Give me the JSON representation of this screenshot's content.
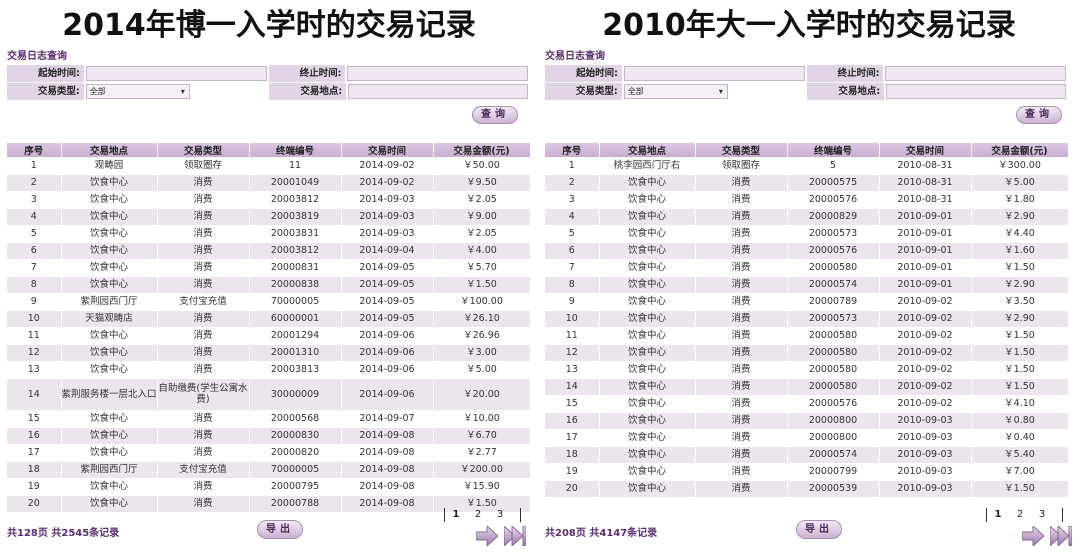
{
  "left": {
    "heading": "2014年博一入学时的交易记录",
    "section_title": "交易日志查询",
    "form": {
      "start_label": "起始时间:",
      "end_label": "终止时间:",
      "type_label": "交易类型:",
      "type_value": "全部",
      "place_label": "交易地点:"
    },
    "query_button": "查询",
    "columns": [
      "序号",
      "交易地点",
      "交易类型",
      "终端编号",
      "交易时间",
      "交易金额(元)"
    ],
    "rows": [
      [
        "1",
        "观畴园",
        "领取圈存",
        "11",
        "2014-09-02",
        "￥50.00"
      ],
      [
        "2",
        "饮食中心",
        "消费",
        "20001049",
        "2014-09-02",
        "￥9.50"
      ],
      [
        "3",
        "饮食中心",
        "消费",
        "20003812",
        "2014-09-03",
        "￥2.05"
      ],
      [
        "4",
        "饮食中心",
        "消费",
        "20003819",
        "2014-09-03",
        "￥9.00"
      ],
      [
        "5",
        "饮食中心",
        "消费",
        "20003831",
        "2014-09-03",
        "￥2.05"
      ],
      [
        "6",
        "饮食中心",
        "消费",
        "20003812",
        "2014-09-04",
        "￥4.00"
      ],
      [
        "7",
        "饮食中心",
        "消费",
        "20000831",
        "2014-09-05",
        "￥5.70"
      ],
      [
        "8",
        "饮食中心",
        "消费",
        "20000838",
        "2014-09-05",
        "￥1.50"
      ],
      [
        "9",
        "紫荆园西门厅",
        "支付宝充值",
        "70000005",
        "2014-09-05",
        "￥100.00"
      ],
      [
        "10",
        "天猫观畴店",
        "消费",
        "60000001",
        "2014-09-05",
        "￥26.10"
      ],
      [
        "11",
        "饮食中心",
        "消费",
        "20001294",
        "2014-09-06",
        "￥26.96"
      ],
      [
        "12",
        "饮食中心",
        "消费",
        "20001310",
        "2014-09-06",
        "￥3.00"
      ],
      [
        "13",
        "饮食中心",
        "消费",
        "20003813",
        "2014-09-06",
        "￥5.00"
      ],
      [
        "14",
        "紫荆服务楼一层北入口",
        "自助缴费(学生公寓水费)",
        "30000009",
        "2014-09-06",
        "￥20.00"
      ],
      [
        "15",
        "饮食中心",
        "消费",
        "20000568",
        "2014-09-07",
        "￥10.00"
      ],
      [
        "16",
        "饮食中心",
        "消费",
        "20000830",
        "2014-09-08",
        "￥6.70"
      ],
      [
        "17",
        "饮食中心",
        "消费",
        "20000820",
        "2014-09-08",
        "￥2.77"
      ],
      [
        "18",
        "紫荆园西门厅",
        "支付宝充值",
        "70000005",
        "2014-09-08",
        "￥200.00"
      ],
      [
        "19",
        "饮食中心",
        "消费",
        "20000795",
        "2014-09-08",
        "￥15.90"
      ],
      [
        "20",
        "饮食中心",
        "消费",
        "20000788",
        "2014-09-08",
        "￥1.50"
      ]
    ],
    "footer_count": "共128页 共2545条记录",
    "export_button": "导出",
    "pages": [
      "1",
      "2",
      "3"
    ]
  },
  "right": {
    "heading": "2010年大一入学时的交易记录",
    "section_title": "交易日志查询",
    "form": {
      "start_label": "起始时间:",
      "end_label": "终止时间:",
      "type_label": "交易类型:",
      "type_value": "全部",
      "place_label": "交易地点:"
    },
    "query_button": "查询",
    "columns": [
      "序号",
      "交易地点",
      "交易类型",
      "终端编号",
      "交易时间",
      "交易金额(元)"
    ],
    "rows": [
      [
        "1",
        "桃李园西门厅右",
        "领取圈存",
        "5",
        "2010-08-31",
        "￥300.00"
      ],
      [
        "2",
        "饮食中心",
        "消费",
        "20000575",
        "2010-08-31",
        "￥5.00"
      ],
      [
        "3",
        "饮食中心",
        "消费",
        "20000576",
        "2010-08-31",
        "￥1.80"
      ],
      [
        "4",
        "饮食中心",
        "消费",
        "20000829",
        "2010-09-01",
        "￥2.90"
      ],
      [
        "5",
        "饮食中心",
        "消费",
        "20000573",
        "2010-09-01",
        "￥4.40"
      ],
      [
        "6",
        "饮食中心",
        "消费",
        "20000576",
        "2010-09-01",
        "￥1.60"
      ],
      [
        "7",
        "饮食中心",
        "消费",
        "20000580",
        "2010-09-01",
        "￥1.50"
      ],
      [
        "8",
        "饮食中心",
        "消费",
        "20000574",
        "2010-09-01",
        "￥2.90"
      ],
      [
        "9",
        "饮食中心",
        "消费",
        "20000789",
        "2010-09-02",
        "￥3.50"
      ],
      [
        "10",
        "饮食中心",
        "消费",
        "20000573",
        "2010-09-02",
        "￥2.90"
      ],
      [
        "11",
        "饮食中心",
        "消费",
        "20000580",
        "2010-09-02",
        "￥1.50"
      ],
      [
        "12",
        "饮食中心",
        "消费",
        "20000580",
        "2010-09-02",
        "￥1.50"
      ],
      [
        "13",
        "饮食中心",
        "消费",
        "20000580",
        "2010-09-02",
        "￥1.50"
      ],
      [
        "14",
        "饮食中心",
        "消费",
        "20000580",
        "2010-09-02",
        "￥1.50"
      ],
      [
        "15",
        "饮食中心",
        "消费",
        "20000576",
        "2010-09-02",
        "￥4.10"
      ],
      [
        "16",
        "饮食中心",
        "消费",
        "20000800",
        "2010-09-03",
        "￥0.80"
      ],
      [
        "17",
        "饮食中心",
        "消费",
        "20000800",
        "2010-09-03",
        "￥0.40"
      ],
      [
        "18",
        "饮食中心",
        "消费",
        "20000574",
        "2010-09-03",
        "￥5.40"
      ],
      [
        "19",
        "饮食中心",
        "消费",
        "20000799",
        "2010-09-03",
        "￥7.00"
      ],
      [
        "20",
        "饮食中心",
        "消费",
        "20000539",
        "2010-09-03",
        "￥1.50"
      ]
    ],
    "footer_count": "共208页 共4147条记录",
    "export_button": "导出",
    "pages": [
      "1",
      "2",
      "3"
    ]
  }
}
